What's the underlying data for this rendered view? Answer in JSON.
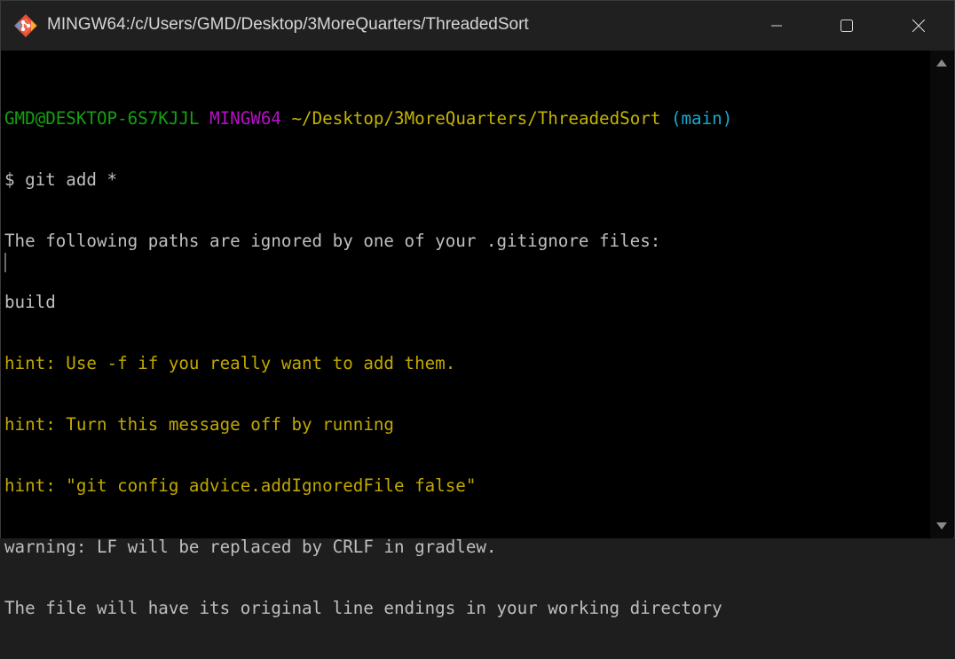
{
  "window": {
    "title": "MINGW64:/c/Users/GMD/Desktop/3MoreQuarters/ThreadedSort",
    "app_icon": "git-bash-icon",
    "controls": {
      "minimize_icon": "minimize-icon",
      "maximize_icon": "maximize-icon",
      "close_icon": "close-icon"
    }
  },
  "terminal": {
    "prompt": {
      "user_host": "GMD@DESKTOP-6S7KJJL",
      "env": "MINGW64",
      "path": "~/Desktop/3MoreQuarters/ThreadedSort",
      "branch": "(main)"
    },
    "command": "$ git add *",
    "output": [
      "The following paths are ignored by one of your .gitignore files:",
      "build",
      "hint: Use -f if you really want to add them.",
      "hint: Turn this message off by running",
      "hint: \"git config advice.addIgnoredFile false\"",
      "warning: LF will be replaced by CRLF in gradlew.",
      "The file will have its original line endings in your working directory"
    ]
  },
  "colors": {
    "background": "#000000",
    "text": "#bfbfbf",
    "user_host": "#13a10e",
    "env": "#b80fc8",
    "path": "#c3b300",
    "branch": "#17aacf",
    "hint": "#c1a800"
  }
}
